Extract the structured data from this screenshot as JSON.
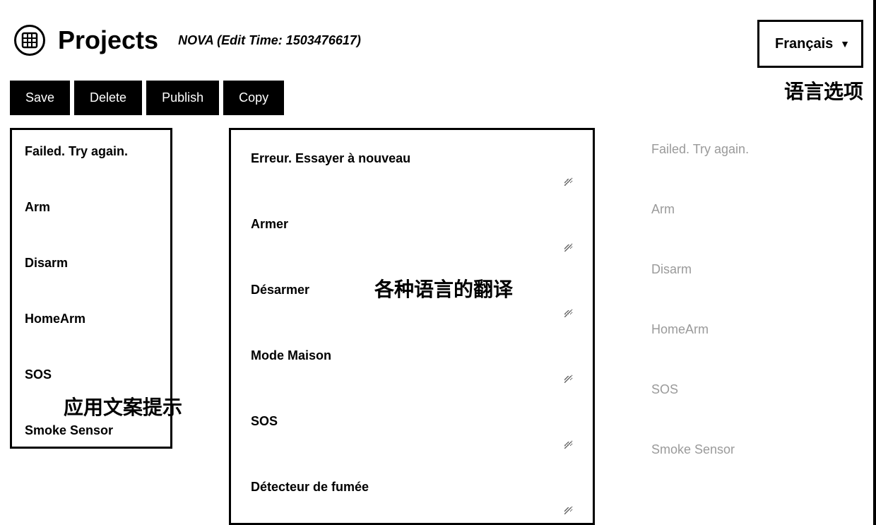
{
  "header": {
    "title": "Projects",
    "subtitle": "NOVA (Edit Time: 1503476617)"
  },
  "language_selector": {
    "selected": "Français",
    "annotation": "语言选项"
  },
  "toolbar": {
    "save": "Save",
    "delete": "Delete",
    "publish": "Publish",
    "copy": "Copy"
  },
  "source_strings": [
    "Failed. Try again.",
    "Arm",
    "Disarm",
    "HomeArm",
    "SOS",
    "Smoke Sensor"
  ],
  "translations": [
    "Erreur. Essayer à nouveau",
    "Armer",
    "Désarmer",
    "Mode Maison",
    "SOS",
    "Détecteur de fumée"
  ],
  "reference_strings": [
    "Failed. Try again.",
    "Arm",
    "Disarm",
    "HomeArm",
    "SOS",
    "Smoke Sensor"
  ],
  "annotations": {
    "source_col": "应用文案提示",
    "translation_col": "各种语言的翻译"
  }
}
